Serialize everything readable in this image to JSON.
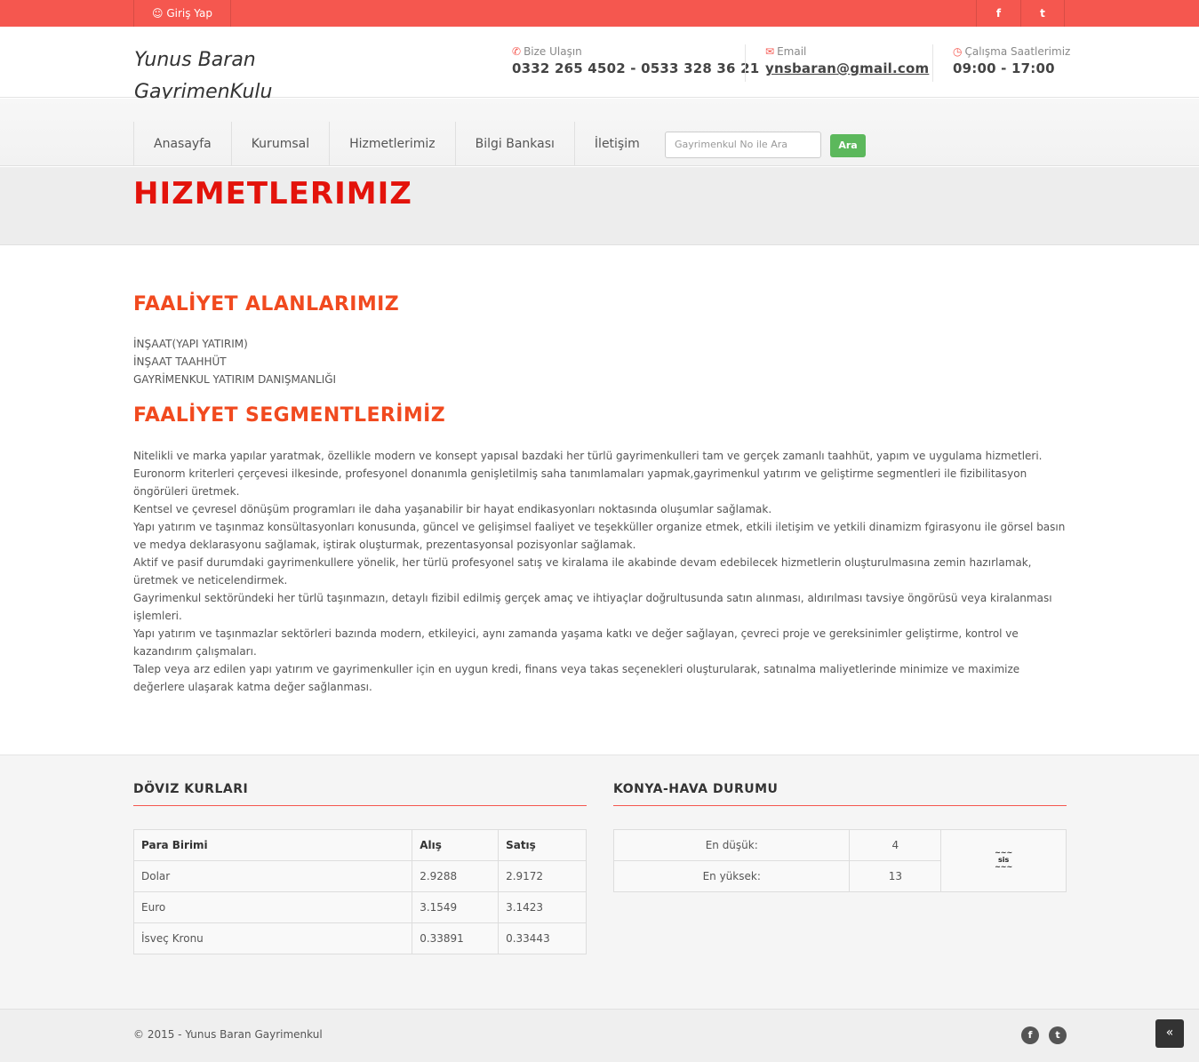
{
  "topbar": {
    "login_label": "Giriş Yap",
    "facebook_glyph": "f",
    "twitter_glyph": "t"
  },
  "header": {
    "logo_line1": "Yunus Baran",
    "logo_line2": "GayrimenKulu",
    "phone_label": "Bize Ulaşın",
    "phone_value": "0332 265 4502 - 0533 328 36 21",
    "email_label": "Email",
    "email_value": "ynsbaran@gmail.com",
    "hours_label": "Çalışma Saatlerimiz",
    "hours_value": "09:00 - 17:00"
  },
  "nav": {
    "items": [
      "Anasayfa",
      "Kurumsal",
      "Hizmetlerimiz",
      "Bilgi Bankası",
      "İletişim"
    ],
    "search_placeholder": "Gayrimenkul No ile Ara",
    "search_button": "Ara"
  },
  "page_title": "HIZMETLERIMIZ",
  "content": {
    "areas_title": "FAALİYET ALANLARIMIZ",
    "areas": [
      "İNŞAAT(YAPI YATIRIM)",
      "İNŞAAT TAAHHÜT",
      "GAYRİMENKUL YATIRIM DANIŞMANLIĞI"
    ],
    "segments_title": "FAALİYET SEGMENTLERİMİZ",
    "segments": [
      "Nitelikli ve marka yapılar yaratmak, özellikle modern ve konsept yapısal bazdaki her türlü gayrimenkulleri tam ve gerçek zamanlı taahhüt, yapım ve uygulama hizmetleri.",
      "Euronorm kriterleri çerçevesi ilkesinde, profesyonel donanımla genişletilmiş saha tanımlamaları yapmak,gayrimenkul yatırım ve geliştirme segmentleri ile fizibilitasyon öngörüleri üretmek.",
      "Kentsel ve çevresel dönüşüm programları ile daha yaşanabilir bir hayat endikasyonları noktasında oluşumlar sağlamak.",
      "Yapı yatırım ve taşınmaz konsültasyonları konusunda, güncel ve gelişimsel faaliyet ve teşekküller organize etmek, etkili iletişim ve yetkili dinamizm fgirasyonu ile görsel basın ve medya deklarasyonu sağlamak, iştirak oluşturmak, prezentasyonsal pozisyonlar sağlamak.",
      "Aktif ve pasif durumdaki gayrimenkullere yönelik, her türlü profesyonel satış ve kiralama ile akabinde devam edebilecek hizmetlerin oluşturulmasına zemin hazırlamak, üretmek ve neticelendirmek.",
      "Gayrimenkul sektöründeki her türlü taşınmazın, detaylı fizibil edilmiş gerçek amaç ve ihtiyaçlar doğrultusunda satın alınması, aldırılması tavsiye öngörüsü veya kiralanması işlemleri.",
      "Yapı yatırım ve taşınmazlar sektörleri bazında modern, etkileyici, aynı zamanda yaşama katkı ve değer sağlayan, çevreci proje ve gereksinimler geliştirme, kontrol ve kazandırım çalışmaları.",
      "Talep veya arz edilen yapı yatırım ve gayrimenkuller için en uygun kredi, finans veya takas seçenekleri oluşturularak, satınalma maliyetlerinde minimize ve maximize değerlere ulaşarak katma değer sağlanması."
    ]
  },
  "doviz": {
    "title": "DÖVIZ KURLARI",
    "headers": [
      "Para Birimi",
      "Alış",
      "Satış"
    ],
    "rows": [
      [
        "Dolar",
        "2.9288",
        "2.9172"
      ],
      [
        "Euro",
        "3.1549",
        "3.1423"
      ],
      [
        "İsveç Kronu",
        "0.33891",
        "0.33443"
      ]
    ]
  },
  "hava": {
    "title": "KONYA-HAVA DURUMU",
    "min_label": "En düşük:",
    "min_value": "4",
    "max_label": "En yüksek:",
    "max_value": "13",
    "icon_text": "sis"
  },
  "footer": {
    "copyright": "© 2015 - Yunus Baran Gayrimenkul",
    "scroll_glyph": "«"
  },
  "colors": {
    "accent": "#f5574f",
    "title_red": "#e3130b",
    "heading_orange": "#f14a1f",
    "search_button": "#5cb85c"
  }
}
